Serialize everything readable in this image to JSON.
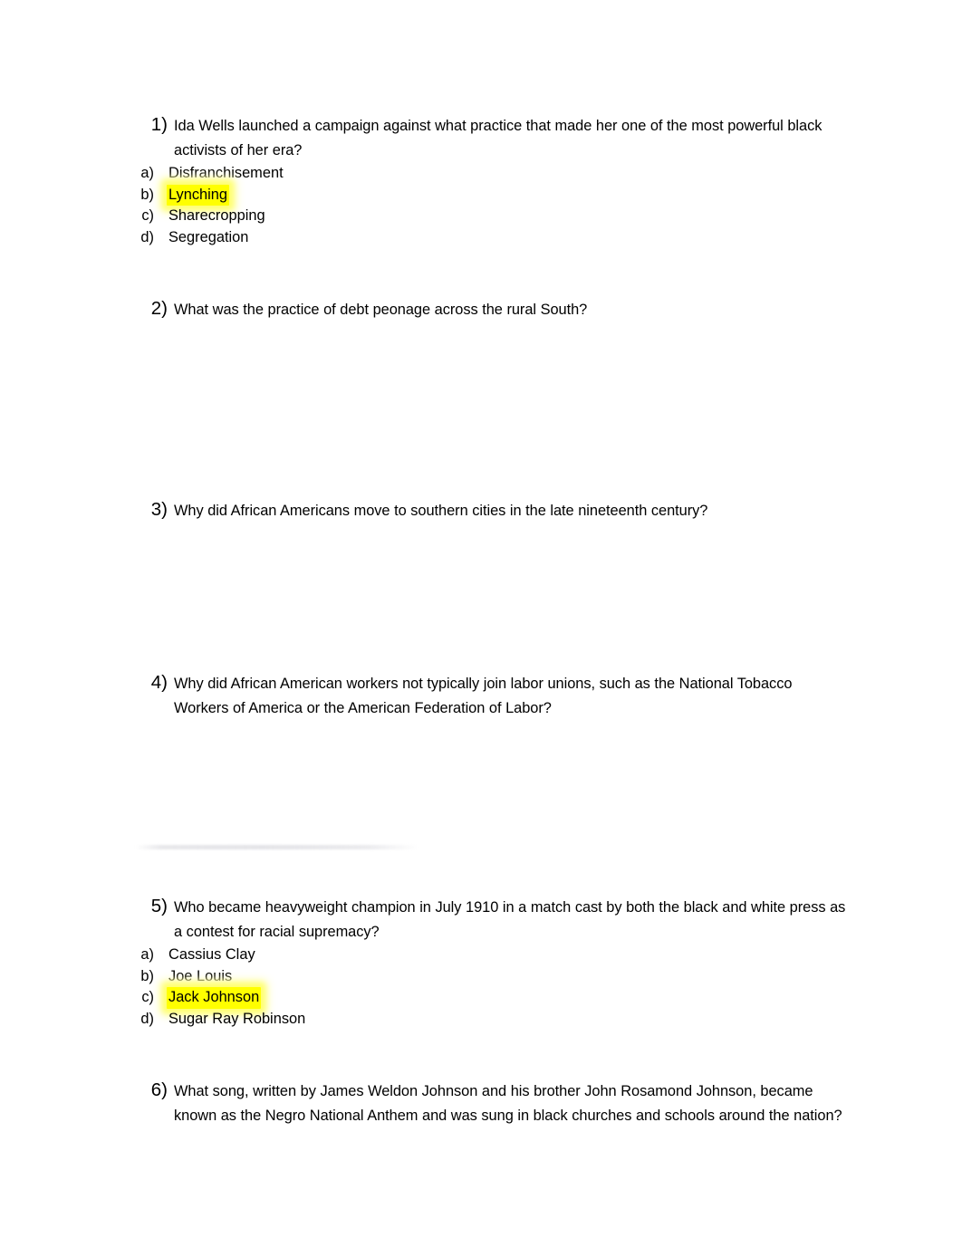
{
  "document": {
    "title": "African American History Quiz",
    "page_background": "#ffffff",
    "text_color": "#000000",
    "highlight_color": "#ffff00",
    "artifact_color": "#e8e8ec"
  },
  "questions": [
    {
      "number": "1)",
      "text": "Ida Wells launched a campaign against what practice that made her one of the most powerful black activists of her era?",
      "options": [
        {
          "marker": "a)",
          "text": "Disfranchisement",
          "highlighted": false
        },
        {
          "marker": "b)",
          "text": "Lynching",
          "highlighted": true
        },
        {
          "marker": "c)",
          "text": "Sharecropping",
          "highlighted": false
        },
        {
          "marker": "d)",
          "text": "Segregation",
          "highlighted": false
        }
      ]
    },
    {
      "number": "2)",
      "text": "What was the practice of debt peonage across the rural South?",
      "options": []
    },
    {
      "number": "3)",
      "text": "Why did African Americans move to southern cities in the late nineteenth century?",
      "options": []
    },
    {
      "number": "4)",
      "text": "Why did African American workers not typically join labor unions, such as the National Tobacco Workers of America or the American Federation of Labor?",
      "options": []
    },
    {
      "number": "5)",
      "text": "Who became heavyweight champion in July 1910 in a match cast by both the black and white press as a contest for racial supremacy?",
      "options": [
        {
          "marker": "a)",
          "text": "Cassius Clay",
          "highlighted": false
        },
        {
          "marker": "b)",
          "text": "Joe Louis",
          "highlighted": false
        },
        {
          "marker": "c)",
          "text": "Jack Johnson",
          "highlighted": true
        },
        {
          "marker": "d)",
          "text": "Sugar Ray Robinson",
          "highlighted": false
        }
      ]
    },
    {
      "number": "6)",
      "text": "What song, written by James Weldon Johnson and his brother John Rosamond Johnson, became known as the Negro National Anthem and was sung in black churches and schools around the nation?",
      "options": []
    }
  ],
  "layout": {
    "question_tops": [
      126,
      329,
      551,
      742,
      989,
      1192
    ],
    "artifact_present": true
  }
}
